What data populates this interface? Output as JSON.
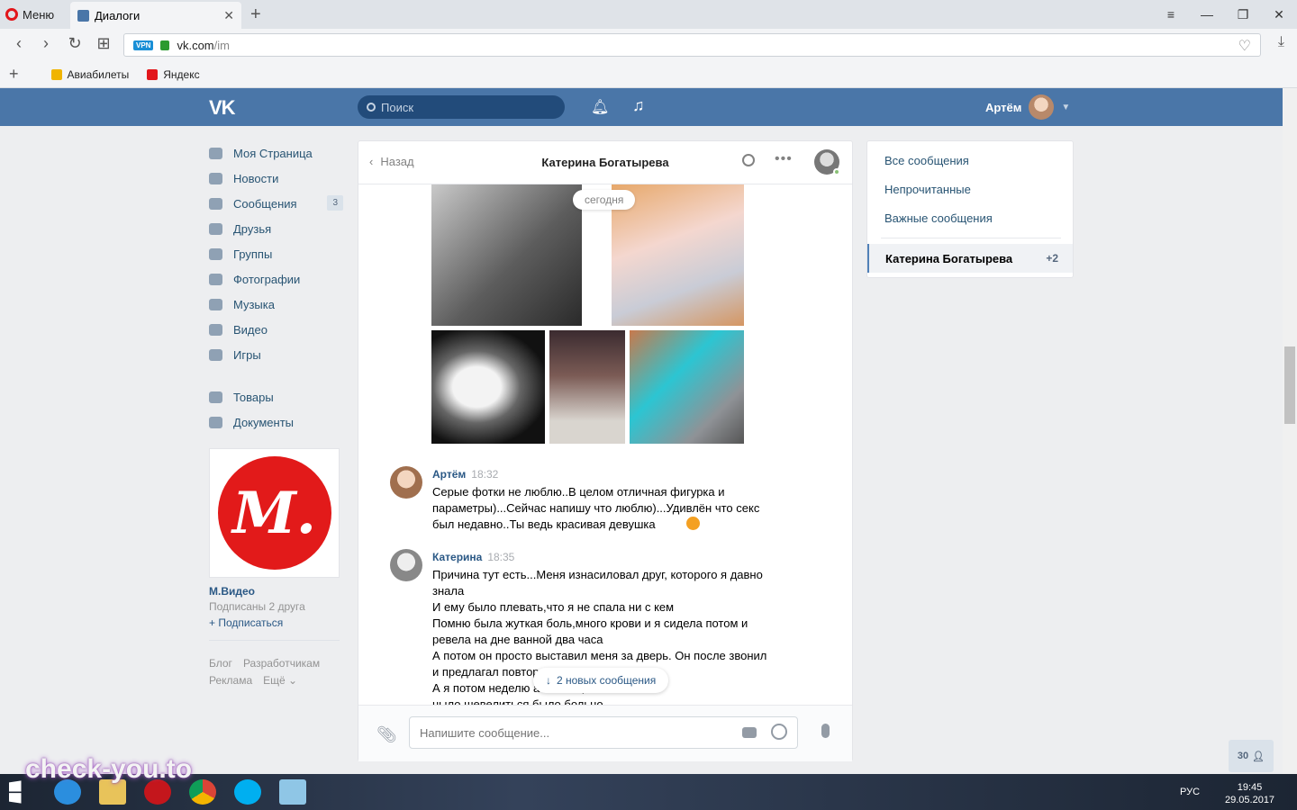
{
  "browser": {
    "menu_label": "Меню",
    "tab_title": "Диалоги",
    "url_host": "vk.com",
    "url_path": "/im",
    "vpn_badge": "VPN",
    "bookmarks": [
      "Авиабилеты",
      "Яндекс"
    ]
  },
  "header": {
    "logo": "VK",
    "search_placeholder": "Поиск",
    "user_name": "Артём"
  },
  "left_menu": {
    "items": [
      {
        "label": "Моя Страница"
      },
      {
        "label": "Новости"
      },
      {
        "label": "Сообщения",
        "badge": "3"
      },
      {
        "label": "Друзья"
      },
      {
        "label": "Группы"
      },
      {
        "label": "Фотографии"
      },
      {
        "label": "Музыка"
      },
      {
        "label": "Видео"
      },
      {
        "label": "Игры"
      }
    ],
    "extra_items": [
      {
        "label": "Товары"
      },
      {
        "label": "Документы"
      }
    ],
    "promo": {
      "logo_text": "М.",
      "name": "М.Видео",
      "subtitle": "Подписаны 2 друга",
      "action": "+ Подписаться"
    },
    "footer": [
      "Блог",
      "Разработчикам",
      "Реклама",
      "Ещё ⌄"
    ]
  },
  "chat": {
    "back_label": "Назад",
    "title": "Катерина Богатырева",
    "date_divider": "сегодня",
    "messages": [
      {
        "author": "Артём",
        "time": "18:32",
        "text": "Серые фотки не люблю..В целом отличная фигурка и\nпараметры)...Сейчас напишу что люблю)...Удивлён что секс\nбыл недавно..Ты ведь красивая девушка"
      },
      {
        "author": "Катерина",
        "time": "18:35",
        "text": "Причина тут есть...Меня изнасиловал друг, которого я давно\nзнала\nИ ему было плевать,что я не спала ни с кем\nПомню была жуткая боль,много крови и я сидела потом и\nревела на дне ванной два часа\nА потом он просто выставил меня за дверь. Он после звонил\nи предлагал повтор\nА я потом неделю                                    а животе, тело\nныло шевелиться было больно"
      }
    ],
    "new_messages": "2 новых сообщения",
    "input_placeholder": "Напишите сообщение..."
  },
  "right_panel": {
    "filters": [
      "Все сообщения",
      "Непрочитанные",
      "Важные сообщения"
    ],
    "active_dialog": "Катерина Богатырева",
    "active_count": "+2"
  },
  "online_count": "30",
  "taskbar": {
    "lang": "РУС",
    "time": "19:45",
    "date": "29.05.2017"
  },
  "watermark": "check-you.to"
}
